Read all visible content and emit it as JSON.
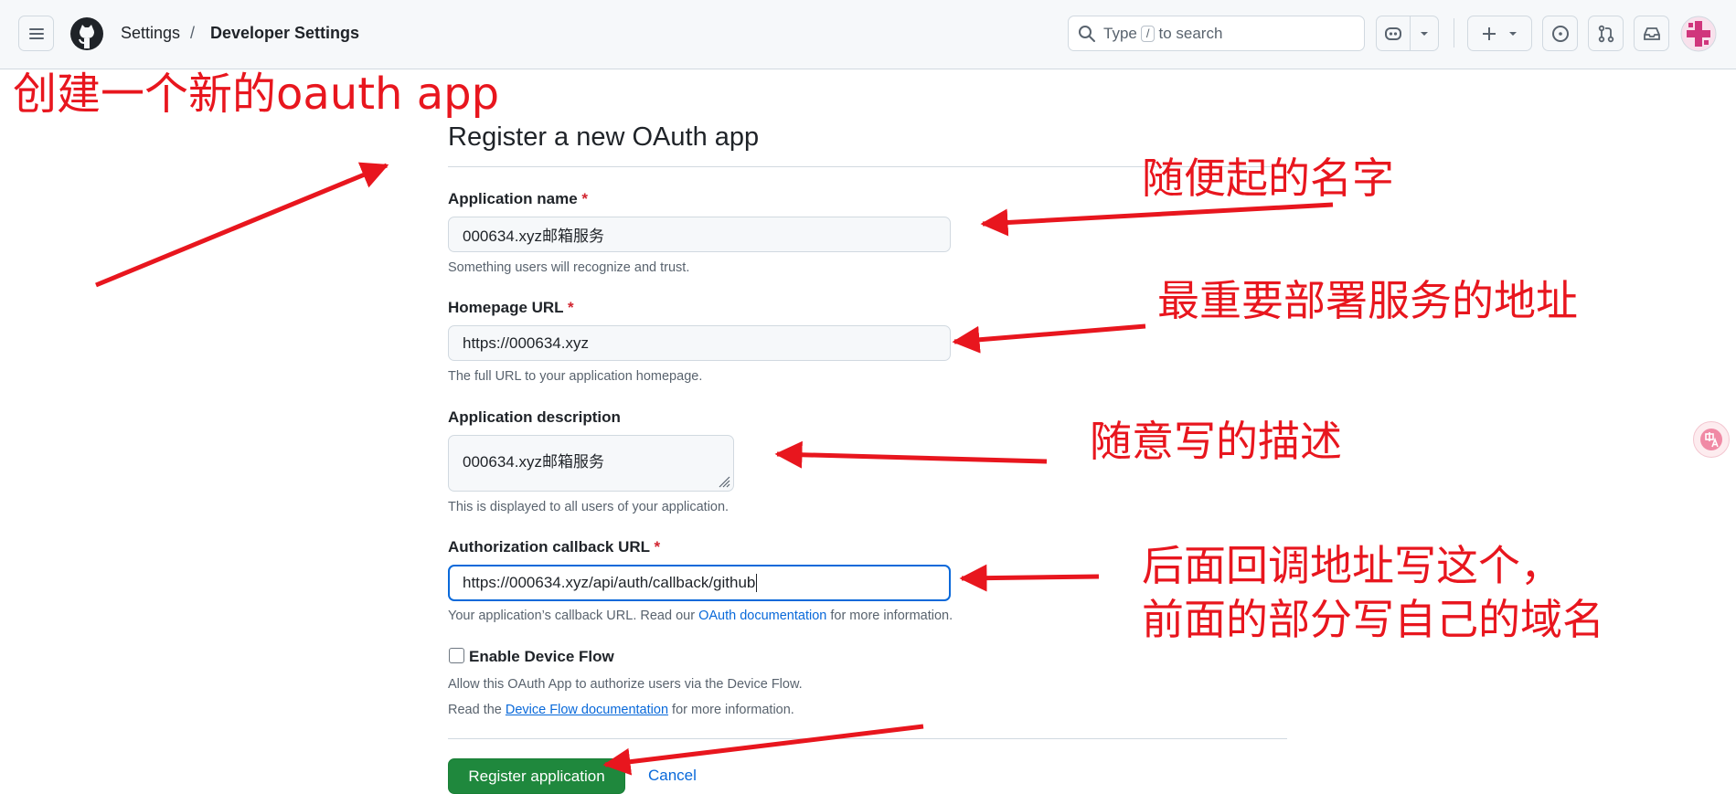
{
  "header": {
    "breadcrumb": {
      "settings": "Settings",
      "separator": "/",
      "current": "Developer Settings"
    },
    "search": {
      "prefix": "Type",
      "key": "/",
      "suffix": "to search"
    },
    "icons": [
      "menu-icon",
      "github-logo-icon",
      "search-icon",
      "copilot-icon",
      "chevron-down-icon",
      "plus-icon",
      "issues-icon",
      "pull-request-icon",
      "inbox-icon",
      "avatar"
    ]
  },
  "form": {
    "title": "Register a new OAuth app",
    "app_name": {
      "label": "Application name",
      "required": "*",
      "value": "000634.xyz邮箱服务",
      "hint": "Something users will recognize and trust."
    },
    "homepage": {
      "label": "Homepage URL",
      "required": "*",
      "value": "https://000634.xyz",
      "hint": "The full URL to your application homepage."
    },
    "description": {
      "label": "Application description",
      "value": "000634.xyz邮箱服务",
      "hint": "This is displayed to all users of your application."
    },
    "callback": {
      "label": "Authorization callback URL",
      "required": "*",
      "value": "https://000634.xyz/api/auth/callback/github",
      "hint_prefix": "Your application’s callback URL. Read our",
      "hint_link": "OAuth documentation",
      "hint_suffix": "for more information."
    },
    "device_flow": {
      "label": "Enable Device Flow",
      "checked": false,
      "hint1": "Allow this OAuth App to authorize users via the Device Flow.",
      "hint2_prefix": "Read the",
      "hint2_link": "Device Flow documentation",
      "hint2_suffix": "for more information."
    },
    "submit_label": "Register application",
    "cancel_label": "Cancel"
  },
  "annotations": {
    "create": "创建一个新的oauth app",
    "name": "随便起的名字",
    "homepage": "最重要部署服务的地址",
    "description": "随意写的描述",
    "callback_line1": "后面回调地址写这个，",
    "callback_line2": "前面的部分写自己的域名"
  },
  "colors": {
    "annotation": "#e8161e",
    "primary_button": "#1f883d",
    "link": "#0969da",
    "focus_border": "#0969da",
    "required": "#d1242f"
  }
}
